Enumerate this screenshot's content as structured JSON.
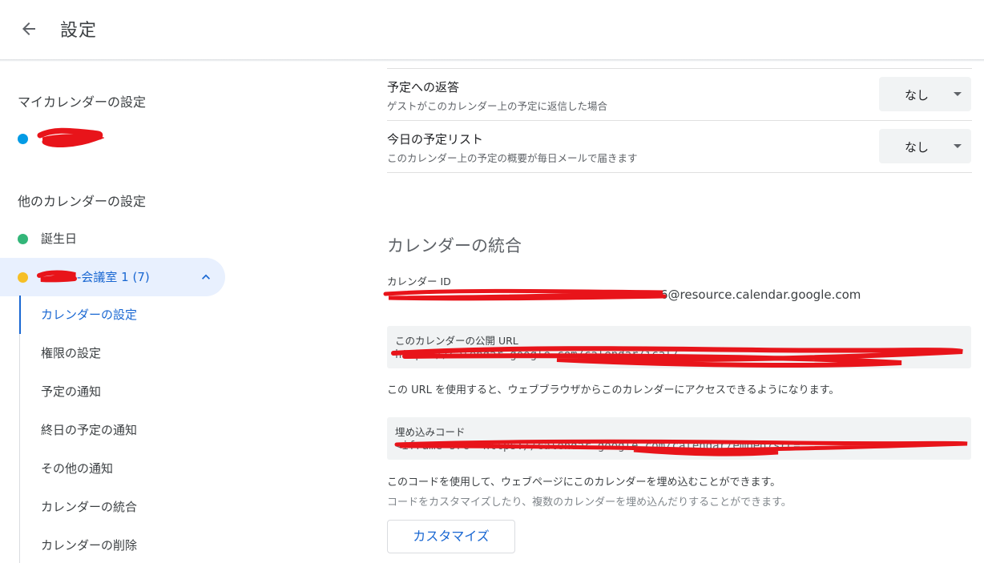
{
  "header": {
    "title": "設定"
  },
  "sidebar": {
    "my_calendars_title": "マイカレンダーの設定",
    "my_calendar": {
      "color": "#039be5"
    },
    "other_calendars_title": "他のカレンダーの設定",
    "birthday": {
      "label": "誕生日",
      "color": "#33b679"
    },
    "room": {
      "label": "-会議室 1 (7)",
      "color": "#f6bf26"
    },
    "sub_items": [
      "カレンダーの設定",
      "権限の設定",
      "予定の通知",
      "終日の予定の通知",
      "その他の通知",
      "カレンダーの統合",
      "カレンダーの削除"
    ]
  },
  "main": {
    "rsvp": {
      "title": "予定への返答",
      "desc": "ゲストがこのカレンダー上の予定に返信した場合",
      "value": "なし"
    },
    "agenda": {
      "title": "今日の予定リスト",
      "desc": "このカレンダー上の予定の概要が毎日メールで届きます",
      "value": "なし"
    },
    "integration_title": "カレンダーの統合",
    "calendar_id_label": "カレンダー ID",
    "calendar_id_value": "6@resource.calendar.google.com",
    "public_url_label": "このカレンダーの公開 URL",
    "public_url_value": "https://calendar.google.com/calendar/ical/",
    "public_url_note": "この URL を使用すると、ウェブブラウザからこのカレンダーにアクセスできるようになります。",
    "embed_label": "埋め込みコード",
    "embed_value": "<iframe src=\"https://calendar.google.com/calendar/embed?src=",
    "embed_note": "このコードを使用して、ウェブページにこのカレンダーを埋め込むことができます。",
    "embed_note2": "コードをカスタマイズしたり、複数のカレンダーを埋め込んだりすることができます。",
    "customize_label": "カスタマイズ"
  },
  "colors": {
    "accent": "#1967d2",
    "redaction": "#e8141a",
    "active_bg": "#e8f0fe"
  }
}
